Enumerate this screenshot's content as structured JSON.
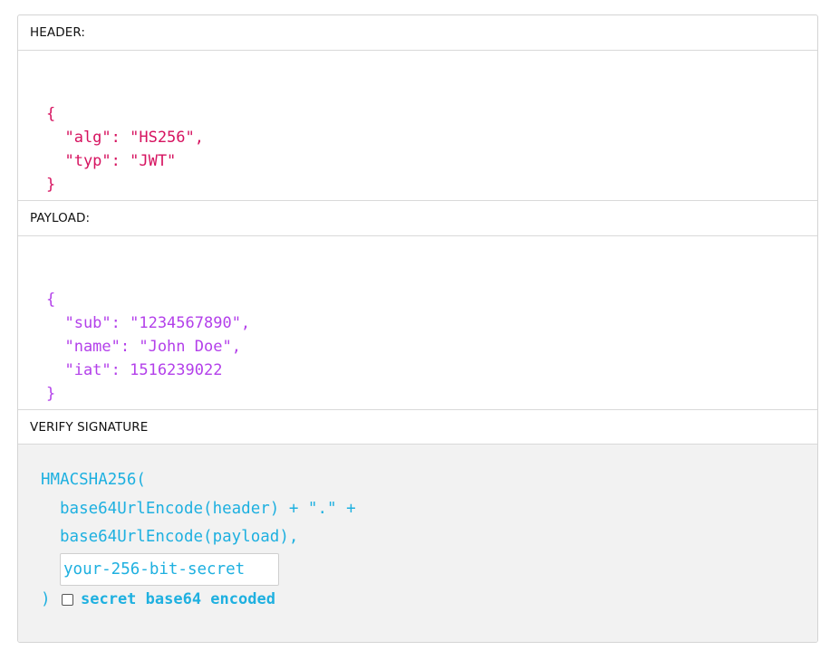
{
  "header": {
    "title": "HEADER:",
    "json_lines": [
      "{",
      "  \"alg\": \"HS256\",",
      "  \"typ\": \"JWT\"",
      "}"
    ]
  },
  "payload": {
    "title": "PAYLOAD:",
    "json_lines": [
      "{",
      "  \"sub\": \"1234567890\",",
      "  \"name\": \"John Doe\",",
      "  \"iat\": 1516239022",
      "}"
    ]
  },
  "verify": {
    "title": "VERIFY SIGNATURE",
    "fn_open": "HMACSHA256(",
    "line1": "base64UrlEncode(header) + \".\" +",
    "line2": "base64UrlEncode(payload),",
    "secret_value": "your-256-bit-secret",
    "fn_close": ")",
    "checkbox_label": "secret base64 encoded",
    "checkbox_checked": false
  },
  "colors": {
    "header_json": "#d6125f",
    "payload_json": "#b340ea",
    "signature": "#1eb0e0"
  }
}
